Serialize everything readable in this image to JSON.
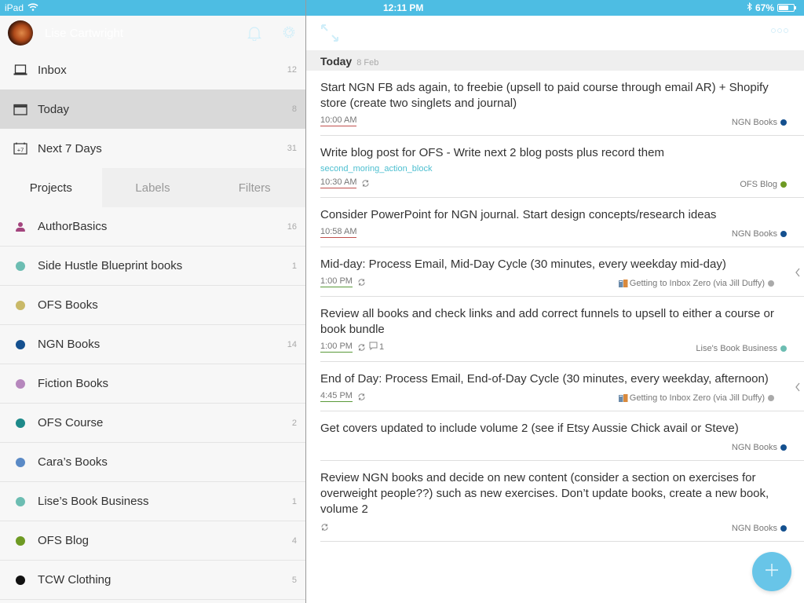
{
  "status_bar": {
    "device": "iPad",
    "time": "12:11 PM",
    "battery": "67%",
    "battery_level": 0.67
  },
  "sidebar": {
    "user_name": "Lise Cartwright",
    "nav": [
      {
        "label": "Inbox",
        "count": "12",
        "icon": "inbox-icon",
        "active": false
      },
      {
        "label": "Today",
        "count": "8",
        "icon": "calendar-icon",
        "active": true
      },
      {
        "label": "Next 7 Days",
        "count": "31",
        "icon": "calendar-plus7-icon",
        "active": false
      }
    ],
    "tabs": [
      {
        "label": "Projects",
        "active": true
      },
      {
        "label": "Labels",
        "active": false
      },
      {
        "label": "Filters",
        "active": false
      }
    ],
    "projects": [
      {
        "label": "AuthorBasics",
        "count": "16",
        "color": "#a3457e",
        "shared": true
      },
      {
        "label": "Side Hustle Blueprint books",
        "count": "1",
        "color": "#6cbdb2"
      },
      {
        "label": "OFS Books",
        "count": "",
        "color": "#c9b968"
      },
      {
        "label": "NGN Books",
        "count": "14",
        "color": "#14508f"
      },
      {
        "label": "Fiction Books",
        "count": "",
        "color": "#b687bd"
      },
      {
        "label": "OFS Course",
        "count": "2",
        "color": "#1e8a8a"
      },
      {
        "label": "Cara’s Books",
        "count": "",
        "color": "#5a8ac6"
      },
      {
        "label": "Lise’s Book Business",
        "count": "1",
        "color": "#6cbdb2"
      },
      {
        "label": "OFS Blog",
        "count": "4",
        "color": "#6e9a23"
      },
      {
        "label": "TCW Clothing",
        "count": "5",
        "color": "#111111"
      }
    ]
  },
  "main": {
    "title": "Today",
    "section": {
      "title": "Today",
      "date": "8 Feb"
    },
    "tasks": [
      {
        "content": "Start NGN FB ads again, to freebie (upsell to paid course through email AR) + Shopify store (create two singlets and journal)",
        "label": "",
        "due": "10:00 AM",
        "due_color": "red",
        "recurring": false,
        "comments": "",
        "project": "NGN Books",
        "project_color": "#14508f",
        "shared_book": false,
        "chevron": false
      },
      {
        "content": "Write blog post for OFS - Write next 2 blog posts plus record them",
        "label": "second_moring_action_block",
        "due": "10:30 AM",
        "due_color": "red",
        "recurring": true,
        "comments": "",
        "project": "OFS Blog",
        "project_color": "#6e9a23",
        "shared_book": false,
        "chevron": false
      },
      {
        "content": "Consider PowerPoint for NGN journal. Start design concepts/research ideas",
        "label": "",
        "due": "10:58 AM",
        "due_color": "red",
        "recurring": false,
        "comments": "",
        "project": "NGN Books",
        "project_color": "#14508f",
        "shared_book": false,
        "chevron": false
      },
      {
        "content": "Mid-day: Process Email, Mid-Day Cycle (30 minutes, every weekday mid-day)",
        "label": "",
        "due": "1:00 PM",
        "due_color": "green",
        "recurring": true,
        "comments": "",
        "project": "Getting to Inbox Zero (via Jill Duffy)",
        "project_color": "#aaaaaa",
        "shared_book": true,
        "chevron": true
      },
      {
        "content": "Review all books and check links and add correct funnels to upsell to either a course or book bundle",
        "label": "",
        "due": "1:00 PM",
        "due_color": "green",
        "recurring": true,
        "comments": "1",
        "project": "Lise's Book Business",
        "project_color": "#6cbdb2",
        "shared_book": false,
        "chevron": false
      },
      {
        "content": "End of Day: Process Email, End-of-Day Cycle (30 minutes, every weekday, afternoon)",
        "label": "",
        "due": "4:45 PM",
        "due_color": "green",
        "recurring": true,
        "comments": "",
        "project": "Getting to Inbox Zero (via Jill Duffy)",
        "project_color": "#aaaaaa",
        "shared_book": true,
        "chevron": true
      },
      {
        "content": "Get covers updated to include volume 2 (see if Etsy Aussie Chick avail or Steve)",
        "label": "",
        "due": "",
        "due_color": "",
        "recurring": false,
        "comments": "",
        "project": "NGN Books",
        "project_color": "#14508f",
        "shared_book": false,
        "chevron": false
      },
      {
        "content": "Review NGN books and decide on new content (consider a section on exercises for overweight people??) such as new exercises. Don’t update books, create a new book, volume 2",
        "label": "",
        "due": "",
        "due_color": "",
        "recurring": true,
        "comments": "",
        "project": "NGN Books",
        "project_color": "#14508f",
        "shared_book": false,
        "chevron": false
      }
    ]
  },
  "colors": {
    "brand": "#4dbde3",
    "fab": "#5cc1e7",
    "label_tag": "#4dbfd0"
  }
}
